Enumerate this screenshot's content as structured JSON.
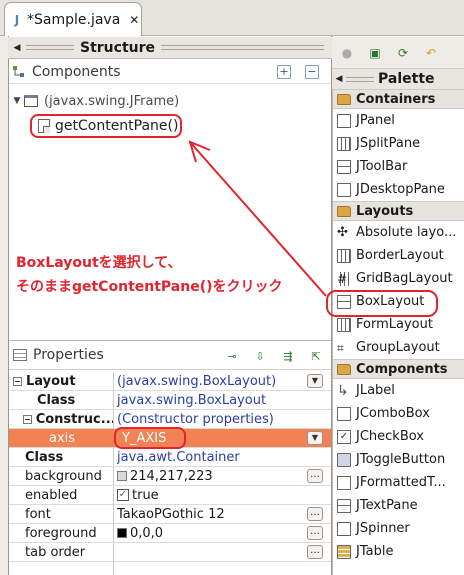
{
  "editor": {
    "tab_label": "*Sample.java",
    "close_glyph": "✕"
  },
  "structure": {
    "title": "Structure",
    "components_title": "Components",
    "tree": [
      {
        "label": "(javax.swing.JFrame)"
      },
      {
        "label": "getContentPane()"
      }
    ]
  },
  "annotation": {
    "line1": "BoxLayoutを選択して、",
    "line2": "そのままgetContentPane()をクリック",
    "color": "#e2242e"
  },
  "properties": {
    "title": "Properties",
    "rows": [
      {
        "key": "Layout",
        "value": "(javax.swing.BoxLayout)"
      },
      {
        "key": "Class",
        "value": "javax.swing.BoxLayout"
      },
      {
        "key": "Construc...",
        "value": "(Constructor properties)"
      },
      {
        "key": "axis",
        "value": "Y_AXIS"
      },
      {
        "key": "Class",
        "value": "java.awt.Container"
      },
      {
        "key": "background",
        "value": "214,217,223"
      },
      {
        "key": "enabled",
        "value": "true"
      },
      {
        "key": "font",
        "value": "TakaoPGothic 12"
      },
      {
        "key": "foreground",
        "value": "0,0,0"
      },
      {
        "key": "tab order",
        "value": ""
      }
    ],
    "selected_color": "#f28153"
  },
  "palette": {
    "title": "Palette",
    "categories": [
      {
        "name": "Containers",
        "items": [
          "JPanel",
          "JSplitPane",
          "JToolBar",
          "JDesktopPane"
        ]
      },
      {
        "name": "Layouts",
        "items": [
          "Absolute layo...",
          "BorderLayout",
          "GridBagLayout",
          "BoxLayout",
          "FormLayout",
          "GroupLayout"
        ]
      },
      {
        "name": "Components",
        "items": [
          "JLabel",
          "JComboBox",
          "JCheckBox",
          "JToggleButton",
          "JFormattedT...",
          "JTextPane",
          "JSpinner",
          "JTable"
        ]
      }
    ]
  }
}
